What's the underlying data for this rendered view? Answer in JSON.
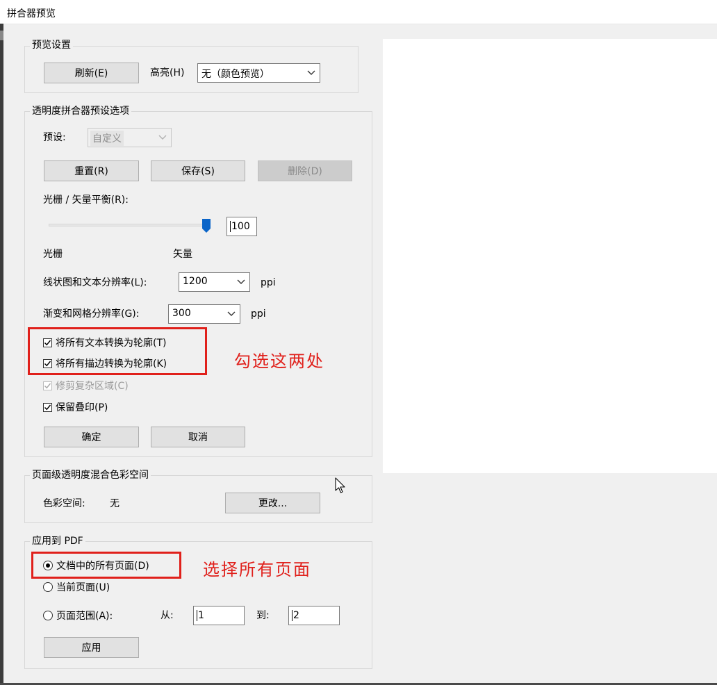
{
  "window": {
    "title": "拼合器预览"
  },
  "preview_settings": {
    "legend": "预览设置",
    "refresh_button": "刷新(E)",
    "highlight_label": "高亮(H)",
    "highlight_value": "无（颜色预览）"
  },
  "flattener_options": {
    "legend": "透明度拼合器预设选项",
    "preset_label": "预设:",
    "preset_value": "自定义",
    "reset_button": "重置(R)",
    "save_button": "保存(S)",
    "delete_button": "删除(D)",
    "balance_label": "光栅 / 矢量平衡(R):",
    "balance_value": "100",
    "balance_fraction": 1.0,
    "raster_label": "光栅",
    "vector_label": "矢量",
    "line_art_label": "线状图和文本分辨率(L):",
    "line_art_value": "1200",
    "line_art_unit": "ppi",
    "gradient_label": "渐变和网格分辨率(G):",
    "gradient_value": "300",
    "gradient_unit": "ppi",
    "checkboxes": [
      {
        "label": "将所有文本转换为轮廓(T)",
        "checked": true,
        "enabled": true
      },
      {
        "label": "将所有描边转换为轮廓(K)",
        "checked": true,
        "enabled": true
      },
      {
        "label": "修剪复杂区域(C)",
        "checked": true,
        "enabled": false
      },
      {
        "label": "保留叠印(P)",
        "checked": true,
        "enabled": true
      }
    ],
    "ok_button": "确定",
    "cancel_button": "取消"
  },
  "blend_space": {
    "legend": "页面级透明度混合色彩空间",
    "color_space_label": "色彩空间:",
    "color_space_value": "无",
    "change_button": "更改..."
  },
  "apply_pdf": {
    "legend": "应用到 PDF",
    "radios": [
      {
        "label": "文档中的所有页面(D)",
        "selected": true
      },
      {
        "label": "当前页面(U)",
        "selected": false
      },
      {
        "label": "页面范围(A):",
        "selected": false
      }
    ],
    "from_label": "从:",
    "from_value": "1",
    "to_label": "到:",
    "to_value": "2",
    "apply_button": "应用"
  },
  "annotations": {
    "note_checkboxes": "勾选这两处",
    "note_pages": "选择所有页面"
  },
  "colors": {
    "annotation_red": "#e0201b",
    "slider_thumb": "#0a64c8"
  }
}
